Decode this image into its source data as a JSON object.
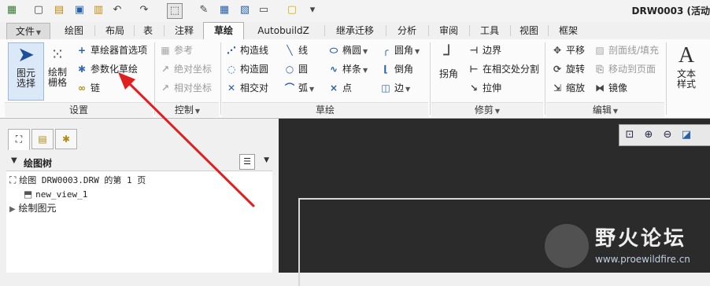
{
  "window": {
    "title": "DRW0003 (活动"
  },
  "tabs": {
    "file": "文件",
    "items": [
      "绘图",
      "布局",
      "表",
      "注释",
      "草绘",
      "AutobuildZ",
      "继承迁移",
      "分析",
      "审阅",
      "工具",
      "视图",
      "框架"
    ],
    "active": "草绘"
  },
  "ribbon": {
    "settings": {
      "select": "图元选择",
      "grid": "绘制栅格",
      "preferences": "草绘器首选项",
      "parametric": "参数化草绘",
      "chain": "链",
      "label": "设置"
    },
    "control": {
      "reference": "参考",
      "absolute": "绝对坐标",
      "relative": "相对坐标",
      "label": "控制"
    },
    "sketch": {
      "construction_line": "构造线",
      "construction_circle": "构造圆",
      "intersect": "相交对",
      "line": "线",
      "circle": "圆",
      "arc": "弧",
      "ellipse": "椭圆",
      "spline": "样条",
      "point": "点",
      "fillet": "圆角",
      "chamfer": "倒角",
      "edge": "边",
      "label": "草绘"
    },
    "trim": {
      "corner": "拐角",
      "boundary": "边界",
      "divide_at_intersect": "在相交处分割",
      "stretch": "拉伸",
      "label": "修剪"
    },
    "edit": {
      "move": "平移",
      "rotate": "旋转",
      "scale": "缩放",
      "section_fill": "剖面线/填充",
      "move_to_page": "移动到页面",
      "mirror": "镜像",
      "label": "编辑"
    },
    "text_style": "文本样式"
  },
  "panel": {
    "tree_title": "绘图树",
    "rows": {
      "drawing": "绘图 DRW0003.DRW 的第 1 页",
      "view": "new_view_1",
      "entities": "绘制图元"
    }
  },
  "watermark": {
    "name": "野火论坛",
    "url": "www.proewildfire.cn"
  },
  "colors": {
    "annotation_arrow": "#e02020",
    "graphics_bg": "#2b2b2b",
    "accent": "#2860a8"
  }
}
